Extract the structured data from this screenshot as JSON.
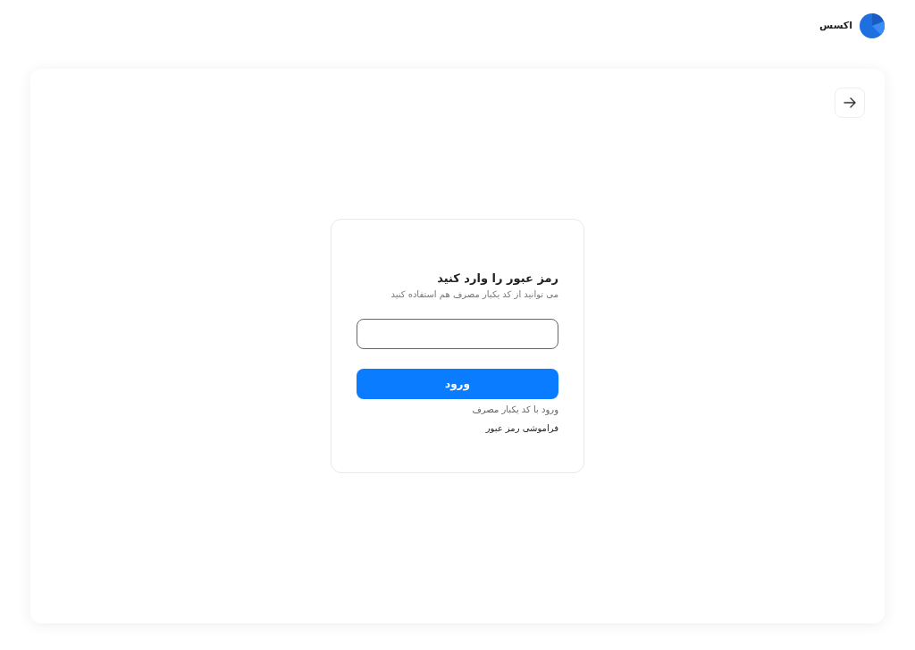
{
  "header": {
    "brand": "اکسس"
  },
  "login": {
    "title": "رمز عبور را وارد کنید",
    "subtitle": "می توانید از کد یکبار مصرف هم استفاده کنید",
    "submit": "ورود",
    "otp_link": "ورود با کد یکبار مصرف",
    "forgot_link": "فراموشی رمز عبور"
  }
}
